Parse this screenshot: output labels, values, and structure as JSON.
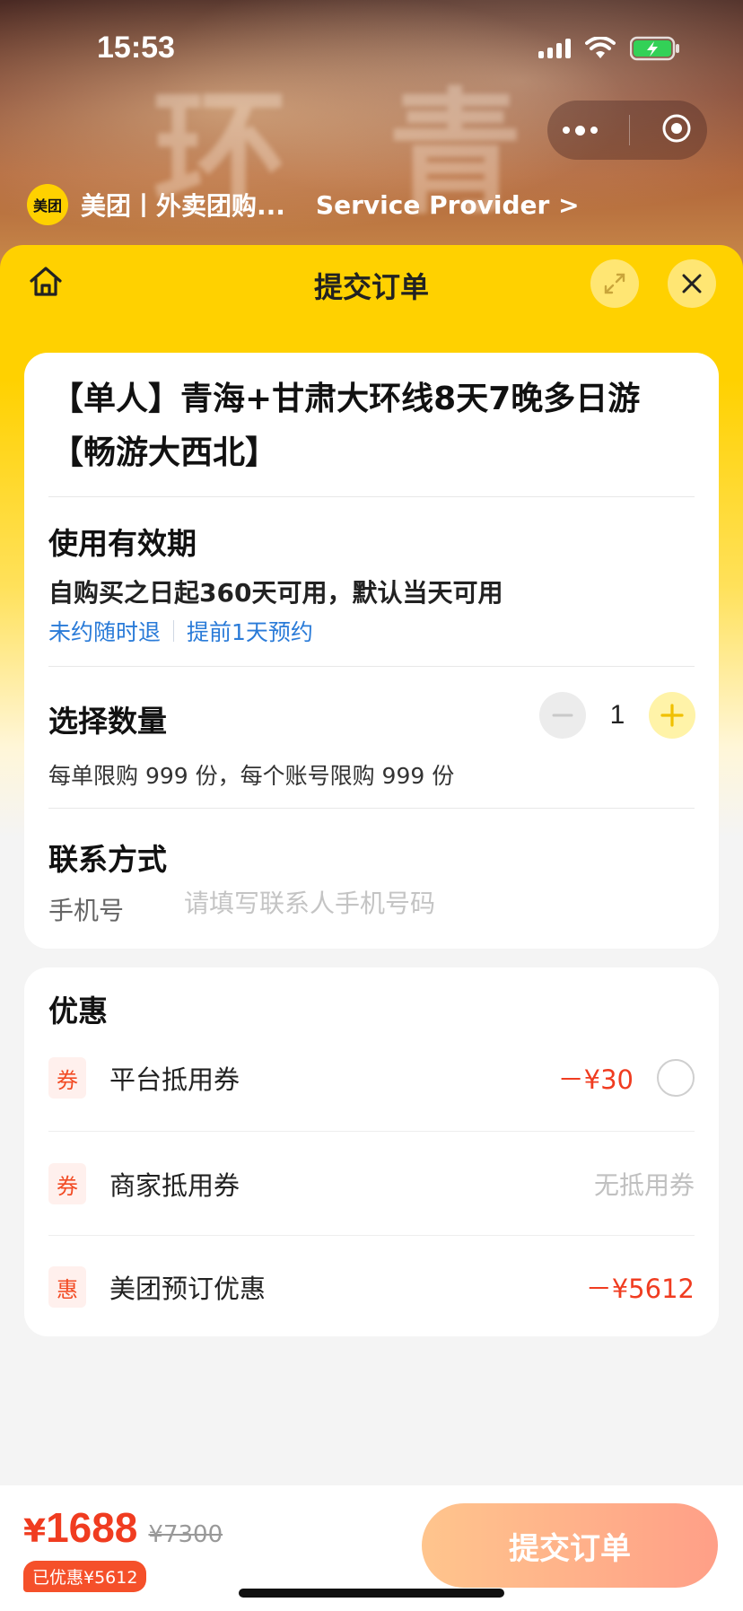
{
  "status_bar": {
    "time": "15:53"
  },
  "mini_program": {
    "logo_text": "美团",
    "name": "美团丨外卖团购...",
    "service_provider": "Service Provider >"
  },
  "header": {
    "title": "提交订单"
  },
  "product": {
    "title": "【单人】青海+甘肃大环线8天7晚多日游【畅游大西北】"
  },
  "validity": {
    "title": "使用有效期",
    "text": "自购买之日起360天可用，默认当天可用",
    "tags": [
      "未约随时退",
      "提前1天预约"
    ]
  },
  "quantity": {
    "title": "选择数量",
    "value": "1",
    "limit_text": "每单限购 999 份，每个账号限购 999 份"
  },
  "contact": {
    "title": "联系方式",
    "phone_label": "手机号",
    "phone_placeholder": "请填写联系人手机号码"
  },
  "discounts": {
    "title": "优惠",
    "items": [
      {
        "badge": "券",
        "name": "平台抵用券",
        "amount": "－¥30"
      },
      {
        "badge": "券",
        "name": "商家抵用券",
        "amount": "无抵用券"
      },
      {
        "badge": "惠",
        "name": "美团预订优惠",
        "amount": "－¥5612"
      }
    ]
  },
  "footer": {
    "currency": "¥",
    "price": "1688",
    "original_price": "¥7300",
    "saved": "已优惠¥5612",
    "submit_label": "提交订单"
  },
  "colors": {
    "brand_yellow": "#ffd100",
    "price_red": "#f03c20",
    "link_blue": "#2a7bd8",
    "submit_gradient_start": "#ffc58d",
    "submit_gradient_end": "#ff9f87"
  }
}
